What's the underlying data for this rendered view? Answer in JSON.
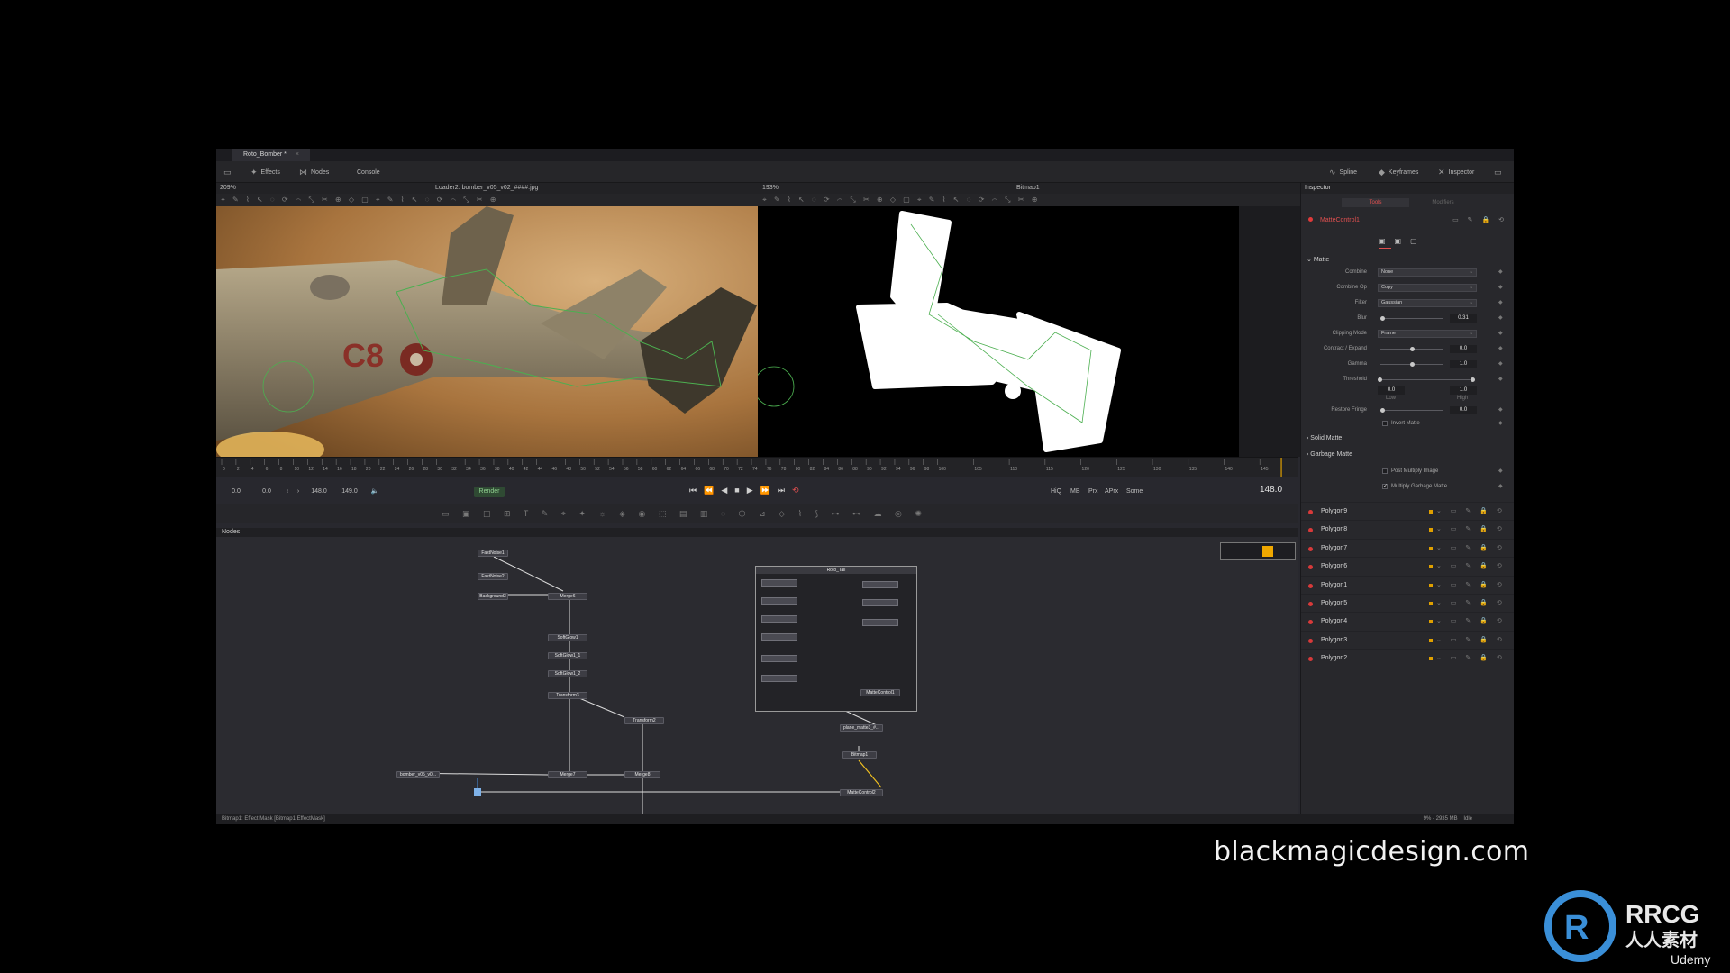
{
  "window": {
    "doc_tab": "Roto_Bomber *",
    "close_glyph": "×"
  },
  "toolbar": {
    "effects": "Effects",
    "nodes": "Nodes",
    "console": "Console",
    "spline": "Spline",
    "keyframes": "Keyframes",
    "inspector": "Inspector"
  },
  "viewer_left": {
    "zoom": "209%",
    "title": "Loader2: bomber_v05_v02_####.jpg"
  },
  "viewer_right": {
    "zoom": "193%",
    "title": "Bitmap1"
  },
  "transport": {
    "start": "0.0",
    "render_start": "0.0",
    "render_end": "148.0",
    "end": "149.0",
    "render_label": "Render",
    "hiq": "HiQ",
    "mb": "MB",
    "prx": "Prx",
    "aprx": "APrx",
    "some": "Some",
    "current_frame": "148.0"
  },
  "ruler": {
    "ticks": [
      "0",
      "2",
      "4",
      "6",
      "8",
      "10",
      "12",
      "14",
      "16",
      "18",
      "20",
      "22",
      "24",
      "26",
      "28",
      "30",
      "32",
      "34",
      "36",
      "38",
      "40",
      "42",
      "44",
      "46",
      "48",
      "50",
      "52",
      "54",
      "56",
      "58",
      "60",
      "62",
      "64",
      "66",
      "68",
      "70",
      "72",
      "74",
      "76",
      "78",
      "80",
      "82",
      "84",
      "86",
      "88",
      "90",
      "92",
      "94",
      "96",
      "98",
      "100",
      "105",
      "110",
      "115",
      "120",
      "125",
      "130",
      "135",
      "140",
      "145"
    ]
  },
  "nodes_panel": {
    "title": "Nodes",
    "nodes": {
      "fastnoise1": "FastNoise1",
      "fastnoise2": "FastNoise2",
      "background3": "Background3",
      "merge6": "Merge6",
      "softglow1": "SoftGlow1",
      "softglow1_1": "SoftGlow1_1",
      "softglow1_2": "SoftGlow1_2",
      "transform3": "Transform3",
      "transform2": "Transform2",
      "merge7": "Merge7",
      "merge8": "Merge8",
      "loader": "bomber_v05_v0...",
      "group": "Roto_Tail",
      "mattecontrol1": "MatteControl1",
      "plane_matte": "plane_matte3_#...",
      "bitmap": "Bitmap1",
      "mattecontrol2": "MatteControl2"
    }
  },
  "status": {
    "left": "Bitmap1: Effect Mask   [Bitmap1.EffectMask]",
    "mem": "9% - 2935 MB",
    "state": "Idle"
  },
  "inspector": {
    "title": "Inspector",
    "tab_tools": "Tools",
    "tab_modifiers": "Modifiers",
    "tool_name": "MatteControl1",
    "section_matte": "Matte",
    "combine_label": "Combine",
    "combine_value": "None",
    "combine_op_label": "Combine Op",
    "combine_op_value": "Copy",
    "filter_label": "Filter",
    "filter_value": "Gaussian",
    "blur_label": "Blur",
    "blur_value": "0.31",
    "clipping_label": "Clipping Mode",
    "clipping_value": "Frame",
    "contract_label": "Contract / Expand",
    "contract_value": "0.0",
    "gamma_label": "Gamma",
    "gamma_value": "1.0",
    "threshold_label": "Threshold",
    "threshold_low": "0.0",
    "threshold_high": "1.0",
    "low_label": "Low",
    "high_label": "High",
    "restore_label": "Restore Fringe",
    "restore_value": "0.0",
    "invert_label": "Invert Matte",
    "section_solid": "Solid Matte",
    "section_garbage": "Garbage Matte",
    "post_multiply": "Post Multiply Image",
    "multiply_garbage": "Multiply Garbage Matte",
    "polygons": [
      "Polygon9",
      "Polygon8",
      "Polygon7",
      "Polygon6",
      "Polygon1",
      "Polygon5",
      "Polygon4",
      "Polygon3",
      "Polygon2"
    ]
  },
  "overlay": {
    "site": "blackmagicdesign.com",
    "logo_text": "RRCG",
    "logo_sub": "人人素材",
    "logo_brand": "Udemy"
  },
  "colors": {
    "accent_red": "#e05050",
    "node_yellow": "#f0a800",
    "roto_green": "#4caf50"
  }
}
